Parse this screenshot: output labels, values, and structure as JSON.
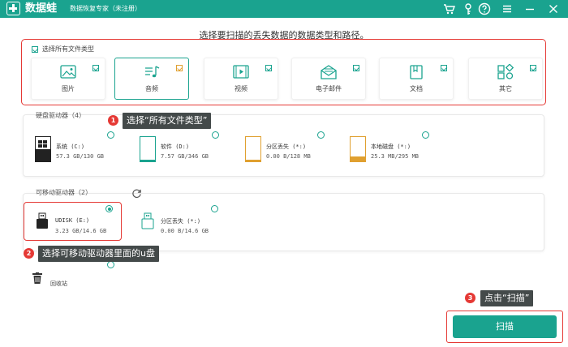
{
  "app": {
    "brand": "数据蛙",
    "subtitle": "数据恢复专家（未注册）"
  },
  "titlebar_icons": [
    "cart-icon",
    "key-icon",
    "help-icon",
    "menu-icon",
    "minimize-icon",
    "close-icon"
  ],
  "heading": "选择要扫描的丢失数据的数据类型和路径。",
  "file_types": {
    "select_all_label": "选择所有文件类型",
    "items": [
      {
        "label": "图片",
        "icon": "image-icon",
        "checked": true
      },
      {
        "label": "音频",
        "icon": "audio-icon",
        "checked": true
      },
      {
        "label": "视频",
        "icon": "video-icon",
        "checked": true
      },
      {
        "label": "电子邮件",
        "icon": "email-icon",
        "checked": true
      },
      {
        "label": "文档",
        "icon": "document-icon",
        "checked": true
      },
      {
        "label": "其它",
        "icon": "other-icon",
        "checked": true
      }
    ]
  },
  "hard_drives": {
    "title": "硬盘驱动器（4）",
    "items": [
      {
        "name": "系统 (C:)",
        "size": "57.3 GB/130 GB"
      },
      {
        "name": "软件 (D:)",
        "size": "7.57 GB/346 GB"
      },
      {
        "name": "分区丢失 (*:)",
        "size": "0.00  B/128 MB"
      },
      {
        "name": "本地磁盘 (*:)",
        "size": "25.3 MB/295 MB"
      }
    ]
  },
  "removable_drives": {
    "title": "可移动驱动器（2）",
    "items": [
      {
        "name": "UDISK (E:)",
        "size": "3.23 GB/14.6 GB",
        "selected": true
      },
      {
        "name": "分区丢失 (*:)",
        "size": "0.00  B/14.6 GB",
        "selected": false
      }
    ]
  },
  "recycle_bin": {
    "label": "回收站"
  },
  "annotations": [
    {
      "num": "1",
      "text": "选择“所有文件类型”"
    },
    {
      "num": "2",
      "text": "选择可移动驱动器里面的u盘"
    },
    {
      "num": "3",
      "text": "点击“扫描”"
    }
  ],
  "scan_button": "扫描",
  "colors": {
    "accent": "#1aa38f",
    "highlight": "#e53935",
    "bubble": "#444a4a"
  }
}
